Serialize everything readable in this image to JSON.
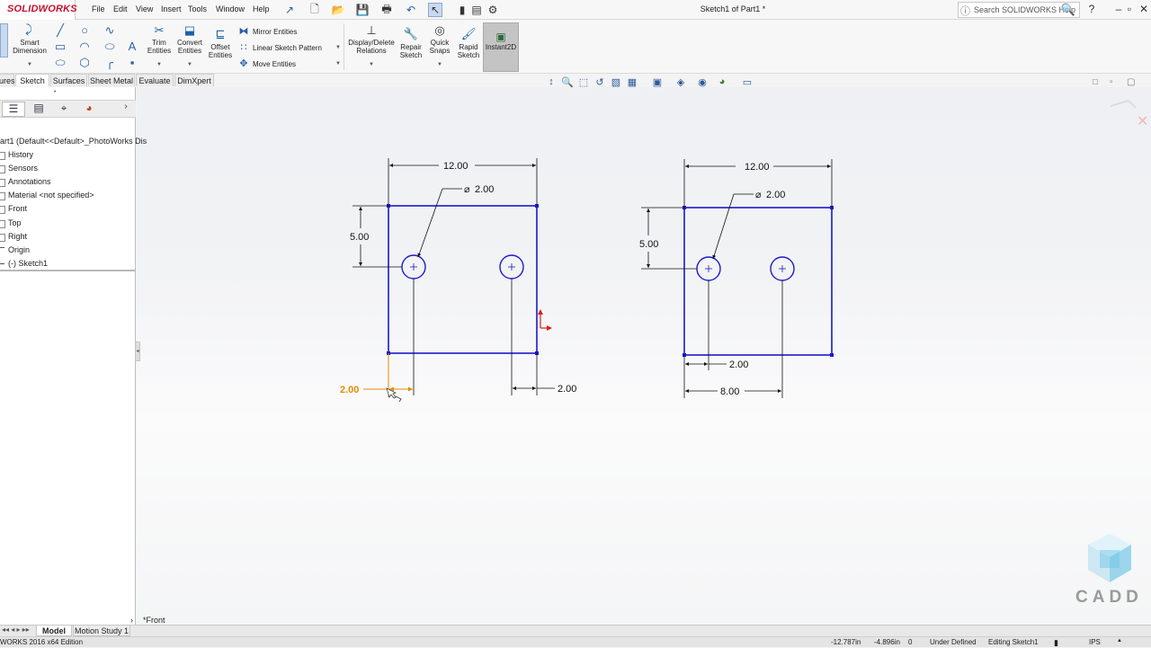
{
  "app": {
    "logo_text": "SOLIDWORKS",
    "document_title": "Sketch1 of Part1 *"
  },
  "menu": [
    "File",
    "Edit",
    "View",
    "Insert",
    "Tools",
    "Window",
    "Help"
  ],
  "search": {
    "placeholder": "Search SOLIDWORKS Help"
  },
  "ribbon": {
    "smart_dimension": "Smart Dimension",
    "trim_entities": "Trim Entities",
    "convert_entities": "Convert Entities",
    "offset_entities": "Offset Entities",
    "mirror_entities": "Mirror Entities",
    "linear_sketch_pattern": "Linear Sketch Pattern",
    "move_entities": "Move Entities",
    "display_delete_relations": "Display/Delete Relations",
    "repair_sketch": "Repair Sketch",
    "quick_snaps": "Quick Snaps",
    "rapid_sketch": "Rapid Sketch",
    "instant2d": "Instant2D"
  },
  "command_tabs": [
    "ures",
    "Sketch",
    "Surfaces",
    "Sheet Metal",
    "Evaluate",
    "DimXpert"
  ],
  "active_command_tab": "Sketch",
  "feature_tree": {
    "root": "art1  (Default<<Default>_PhotoWorks Dis",
    "items": [
      "History",
      "Sensors",
      "Annotations",
      "Material <not specified>",
      "Front",
      "Top",
      "Right",
      "Origin",
      "(-) Sketch1"
    ]
  },
  "viewport": {
    "view_name": "*Front"
  },
  "sketch_left": {
    "dim_width": "12.00",
    "dim_hole": "2.00",
    "dim_height": "5.00",
    "dim_right_offset": "2.00",
    "dim_active": "2.00"
  },
  "sketch_right": {
    "dim_width": "12.00",
    "dim_hole": "2.00",
    "dim_height": "5.00",
    "dim_left_offset": "2.00",
    "dim_spacing": "8.00"
  },
  "watermark": {
    "text": "CADD"
  },
  "bottom_tabs": [
    "Model",
    "Motion Study 1"
  ],
  "status": {
    "edition": "WORKS 2016 x64 Edition",
    "x": "-12.787in",
    "y": "-4.896in",
    "z": "0",
    "state": "Under Defined",
    "mode": "Editing Sketch1",
    "units": "IPS"
  },
  "colors": {
    "sketch_line": "#1a1acc",
    "active_dimension": "#e58c00",
    "origin_marker": "#d22222",
    "logo_red": "#c8102e"
  }
}
